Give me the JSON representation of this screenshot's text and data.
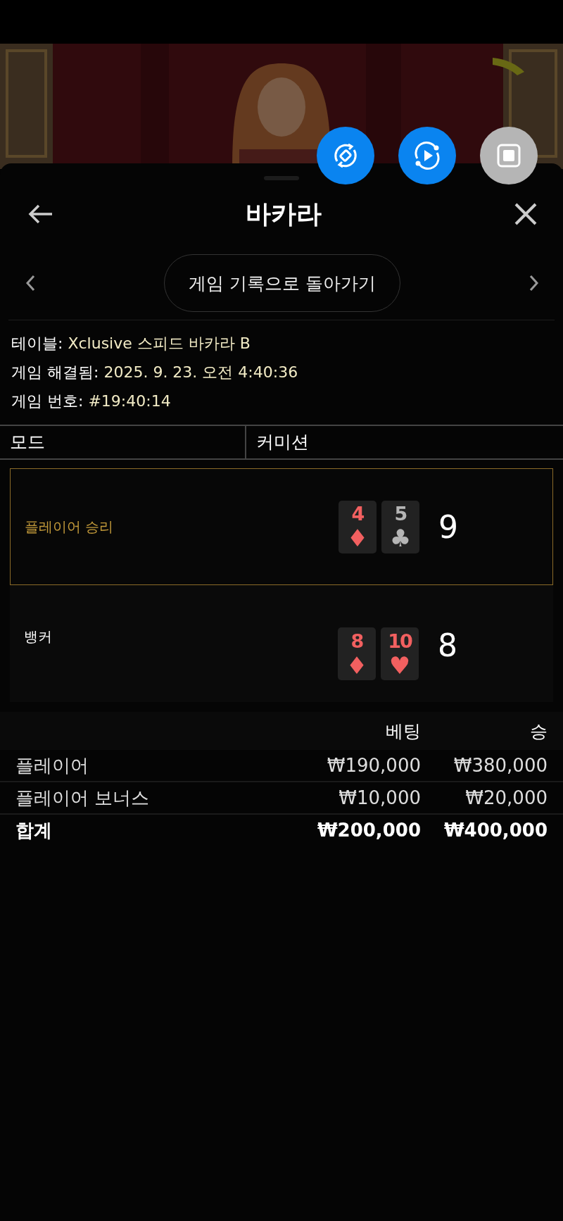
{
  "header": {
    "title": "바카라"
  },
  "nav": {
    "back_to_history": "게임 기록으로 돌아가기"
  },
  "info": [
    {
      "label": "테이블:",
      "value": "Xclusive 스피드 바카라 B"
    },
    {
      "label": "게임 해결됨:",
      "value": "2025. 9. 23. 오전 4:40:36"
    },
    {
      "label": "게임 번호:",
      "value": "#19:40:14"
    }
  ],
  "mode_table": {
    "columns": [
      "모드",
      "커미션"
    ]
  },
  "hands": [
    {
      "label": "플레이어 승리",
      "winner": true,
      "cards": [
        {
          "rank": "4",
          "suit": "♦",
          "color": "#f26060"
        },
        {
          "rank": "5",
          "suit": "♣",
          "color": "#b5b5b5"
        }
      ],
      "score": "9"
    },
    {
      "label": "뱅커",
      "winner": false,
      "cards": [
        {
          "rank": "8",
          "suit": "♦",
          "color": "#f26060"
        },
        {
          "rank": "10",
          "suit": "♥",
          "color": "#f26060"
        }
      ],
      "score": "8"
    }
  ],
  "bets": {
    "columns": [
      "베팅",
      "승"
    ],
    "rows": [
      {
        "kind": "bet",
        "name": "플레이어",
        "bet": "₩190,000",
        "win": "₩380,000"
      },
      {
        "kind": "bet",
        "name": "플레이어 보너스",
        "bet": "₩10,000",
        "win": "₩20,000"
      },
      {
        "kind": "total",
        "name": "합계",
        "bet": "₩200,000",
        "win": "₩400,000"
      }
    ]
  }
}
